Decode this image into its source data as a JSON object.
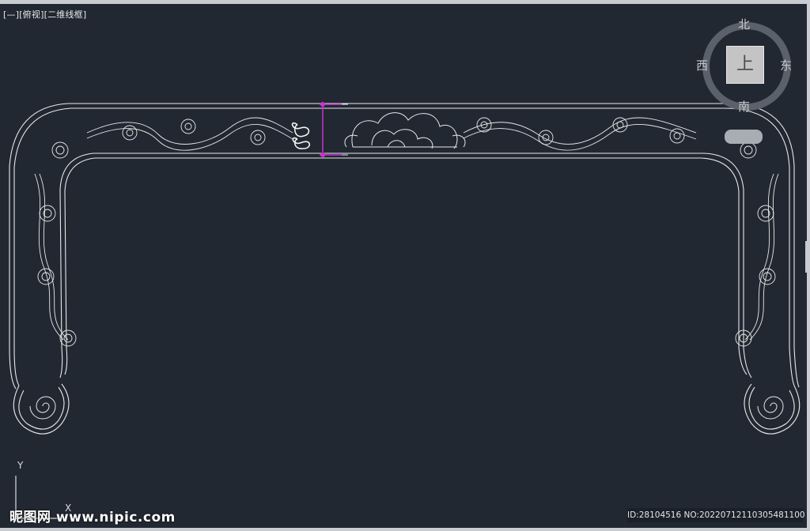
{
  "viewport": {
    "controls_label": "[—]",
    "view_label": "[俯视]",
    "style_label": "[二维线框]"
  },
  "viewcube": {
    "north": "北",
    "south": "南",
    "east": "东",
    "west": "西",
    "face": "上",
    "wcs": ""
  },
  "ucs": {
    "x_label": "X",
    "y_label": "Y"
  },
  "watermark": {
    "site": "昵图网 www.nipic.com",
    "id_text": "ID:28104516 NO:20220712110305481100"
  },
  "colors": {
    "background": "#212832",
    "linework": "#e8e8e8",
    "selection": "#c832d2",
    "viewcube_ring": "#5a616b",
    "viewcube_face": "#c4c4c4"
  }
}
